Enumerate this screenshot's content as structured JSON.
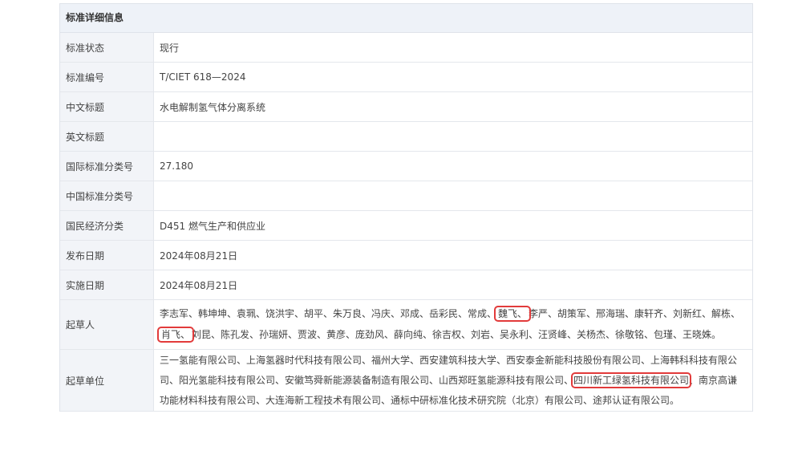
{
  "section_title": "标准详细信息",
  "rows": [
    {
      "label": "标准状态",
      "value": "现行"
    },
    {
      "label": "标准编号",
      "value": "T/CIET 618—2024"
    },
    {
      "label": "中文标题",
      "value": "水电解制氢气体分离系统"
    },
    {
      "label": "英文标题",
      "value": ""
    },
    {
      "label": "国际标准分类号",
      "value": "27.180"
    },
    {
      "label": "中国标准分类号",
      "value": ""
    },
    {
      "label": "国民经济分类",
      "value": "D451 燃气生产和供应业"
    },
    {
      "label": "发布日期",
      "value": "2024年08月21日"
    },
    {
      "label": "实施日期",
      "value": "2024年08月21日"
    }
  ],
  "drafters": {
    "label": "起草人",
    "before_first_highlight": "李志军、韩坤坤、袁珮、饶洪宇、胡平、朱万良、冯庆、邓成、岳彩民、常成、",
    "highlight_1": "魏飞、",
    "middle": "李严、胡策军、邢海瑞、康轩齐、刘新红、解栋、",
    "highlight_2": "肖飞、",
    "after": "刘昆、陈孔发、孙瑞妍、贾波、黄彦、庞劲风、薛向纯、徐吉权、刘岩、吴永利、汪贤峰、关杨杰、徐敬铭、包瑾、王晓姝。"
  },
  "units": {
    "label": "起草单位",
    "before_highlight": "三一氢能有限公司、上海氢器时代科技有限公司、福州大学、西安建筑科技大学、西安泰金新能科技股份有限公司、上海韩科科技有限公司、阳光氢能科技有限公司、安徽笃舜新能源装备制造有限公司、山西郑旺氢能源科技有限公司、",
    "highlight": "四川新工绿氢科技有限公司",
    "after": "、南京高谦功能材料科技有限公司、大连海新工程技术有限公司、通标中研标准化技术研究院（北京）有限公司、途邦认证有限公司。"
  },
  "colors": {
    "highlight_border": "#e23b3b",
    "label_bg": "#f2f4f8",
    "header_bg": "#eef2f8"
  }
}
